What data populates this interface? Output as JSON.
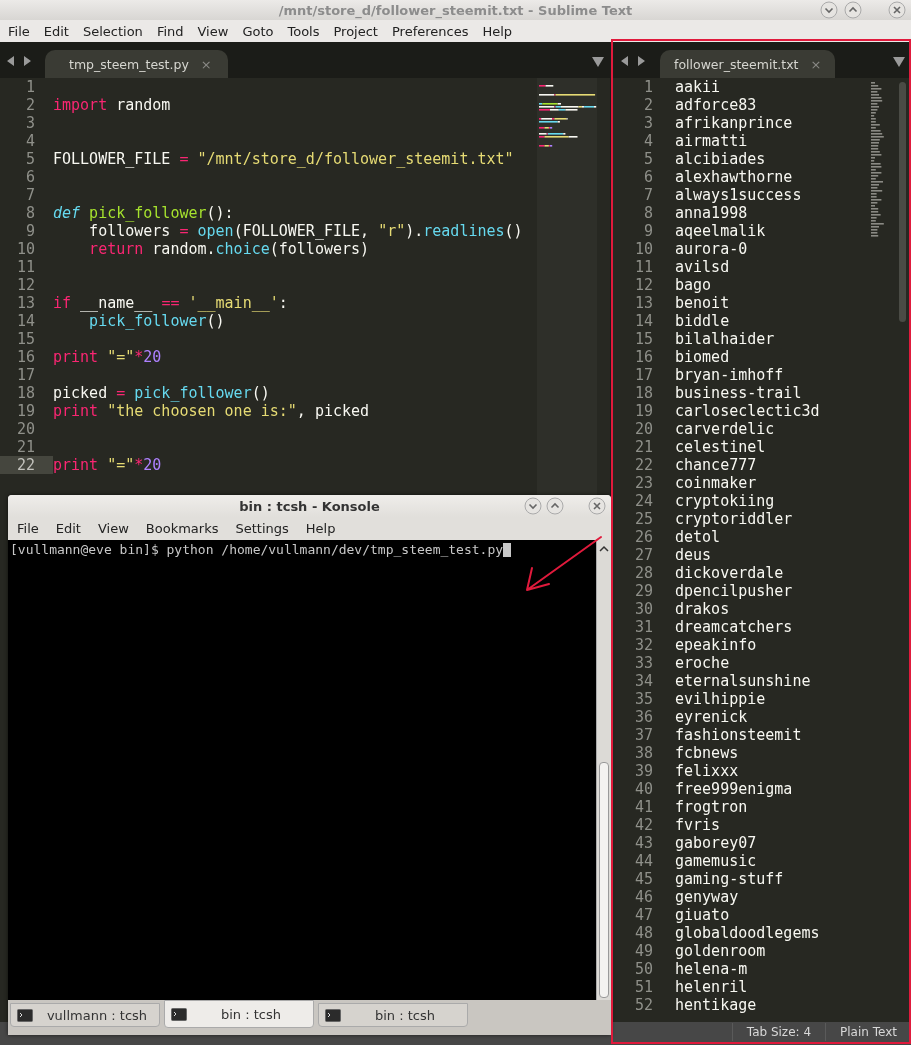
{
  "window": {
    "title": "/mnt/store_d/follower_steemit.txt - Sublime Text"
  },
  "menu": [
    "File",
    "Edit",
    "Selection",
    "Find",
    "View",
    "Goto",
    "Tools",
    "Project",
    "Preferences",
    "Help"
  ],
  "editor": {
    "tab": {
      "label": "tmp_steem_test.py",
      "close": "×"
    },
    "lines": [
      {
        "number": "1",
        "current": false
      },
      {
        "number": "2",
        "current": false,
        "tokens": [
          {
            "kind": "kw",
            "text": "import"
          },
          {
            "kind": "plain",
            "text": " random"
          }
        ]
      },
      {
        "number": "3",
        "current": false
      },
      {
        "number": "4",
        "current": false
      },
      {
        "number": "5",
        "current": false,
        "tokens": [
          {
            "kind": "plain",
            "text": "FOLLOWER_FILE "
          },
          {
            "kind": "kw",
            "text": "="
          },
          {
            "kind": "str",
            "text": " \"/mnt/store_d/follower_steemit.txt\""
          }
        ]
      },
      {
        "number": "6",
        "current": false
      },
      {
        "number": "7",
        "current": false
      },
      {
        "number": "8",
        "current": false,
        "tokens": [
          {
            "kind": "def",
            "text": "def"
          },
          {
            "kind": "fn",
            "text": " pick_follower"
          },
          {
            "kind": "plain",
            "text": "():"
          }
        ]
      },
      {
        "number": "9",
        "current": false,
        "tokens": [
          {
            "kind": "plain",
            "text": "    followers "
          },
          {
            "kind": "kw",
            "text": "="
          },
          {
            "kind": "call",
            "text": " open"
          },
          {
            "kind": "plain",
            "text": "(FOLLOWER_FILE, "
          },
          {
            "kind": "str",
            "text": "\"r\""
          },
          {
            "kind": "plain",
            "text": ")."
          },
          {
            "kind": "call",
            "text": "readlines"
          },
          {
            "kind": "plain",
            "text": "()"
          }
        ]
      },
      {
        "number": "10",
        "current": false,
        "tokens": [
          {
            "kind": "kw",
            "text": "    return"
          },
          {
            "kind": "plain",
            "text": " random."
          },
          {
            "kind": "call",
            "text": "choice"
          },
          {
            "kind": "plain",
            "text": "(followers)"
          }
        ]
      },
      {
        "number": "11",
        "current": false
      },
      {
        "number": "12",
        "current": false
      },
      {
        "number": "13",
        "current": false,
        "tokens": [
          {
            "kind": "kw",
            "text": "if"
          },
          {
            "kind": "plain",
            "text": " __name__ "
          },
          {
            "kind": "kw",
            "text": "=="
          },
          {
            "kind": "str",
            "text": " '__main__'"
          },
          {
            "kind": "plain",
            "text": ":"
          }
        ]
      },
      {
        "number": "14",
        "current": false,
        "tokens": [
          {
            "kind": "call",
            "text": "    pick_follower"
          },
          {
            "kind": "plain",
            "text": "()"
          }
        ]
      },
      {
        "number": "15",
        "current": false
      },
      {
        "number": "16",
        "current": false,
        "tokens": [
          {
            "kind": "kw",
            "text": "print"
          },
          {
            "kind": "str",
            "text": " \"=\""
          },
          {
            "kind": "kw",
            "text": "*"
          },
          {
            "kind": "num",
            "text": "20"
          }
        ]
      },
      {
        "number": "17",
        "current": false
      },
      {
        "number": "18",
        "current": false,
        "tokens": [
          {
            "kind": "plain",
            "text": "picked "
          },
          {
            "kind": "kw",
            "text": "="
          },
          {
            "kind": "call",
            "text": " pick_follower"
          },
          {
            "kind": "plain",
            "text": "()"
          }
        ]
      },
      {
        "number": "19",
        "current": false,
        "tokens": [
          {
            "kind": "kw",
            "text": "print"
          },
          {
            "kind": "str",
            "text": " \"the choosen one is:\""
          },
          {
            "kind": "plain",
            "text": ", picked"
          }
        ]
      },
      {
        "number": "20",
        "current": false
      },
      {
        "number": "21",
        "current": false
      },
      {
        "number": "22",
        "current": true,
        "tokens": [
          {
            "kind": "kw",
            "text": "print"
          },
          {
            "kind": "str",
            "text": " \"=\""
          },
          {
            "kind": "kw",
            "text": "*"
          },
          {
            "kind": "num",
            "text": "20"
          }
        ]
      }
    ]
  },
  "followers": {
    "tab": {
      "label": "follower_steemit.txt",
      "close": "×"
    },
    "lines": [
      {
        "number": "1",
        "text": "aakii"
      },
      {
        "number": "2",
        "text": "adforce83"
      },
      {
        "number": "3",
        "text": "afrikanprince"
      },
      {
        "number": "4",
        "text": "airmatti"
      },
      {
        "number": "5",
        "text": "alcibiades"
      },
      {
        "number": "6",
        "text": "alexhawthorne"
      },
      {
        "number": "7",
        "text": "always1success"
      },
      {
        "number": "8",
        "text": "anna1998"
      },
      {
        "number": "9",
        "text": "aqeelmalik"
      },
      {
        "number": "10",
        "text": "aurora-0"
      },
      {
        "number": "11",
        "text": "avilsd"
      },
      {
        "number": "12",
        "text": "bago"
      },
      {
        "number": "13",
        "text": "benoit"
      },
      {
        "number": "14",
        "text": "biddle"
      },
      {
        "number": "15",
        "text": "bilalhaider"
      },
      {
        "number": "16",
        "text": "biomed"
      },
      {
        "number": "17",
        "text": "bryan-imhoff"
      },
      {
        "number": "18",
        "text": "business-trail"
      },
      {
        "number": "19",
        "text": "carloseclectic3d"
      },
      {
        "number": "20",
        "text": "carverdelic"
      },
      {
        "number": "21",
        "text": "celestinel"
      },
      {
        "number": "22",
        "text": "chance777"
      },
      {
        "number": "23",
        "text": "coinmaker"
      },
      {
        "number": "24",
        "text": "cryptokiing"
      },
      {
        "number": "25",
        "text": "cryptoriddler"
      },
      {
        "number": "26",
        "text": "detol"
      },
      {
        "number": "27",
        "text": "deus"
      },
      {
        "number": "28",
        "text": "dickoverdale"
      },
      {
        "number": "29",
        "text": "dpencilpusher"
      },
      {
        "number": "30",
        "text": "drakos"
      },
      {
        "number": "31",
        "text": "dreamcatchers"
      },
      {
        "number": "32",
        "text": "epeakinfo"
      },
      {
        "number": "33",
        "text": "eroche"
      },
      {
        "number": "34",
        "text": "eternalsunshine"
      },
      {
        "number": "35",
        "text": "evilhippie"
      },
      {
        "number": "36",
        "text": "eyrenick"
      },
      {
        "number": "37",
        "text": "fashionsteemit"
      },
      {
        "number": "38",
        "text": "fcbnews"
      },
      {
        "number": "39",
        "text": "felixxx"
      },
      {
        "number": "40",
        "text": "free999enigma"
      },
      {
        "number": "41",
        "text": "frogtron"
      },
      {
        "number": "42",
        "text": "fvris"
      },
      {
        "number": "43",
        "text": "gaborey07"
      },
      {
        "number": "44",
        "text": "gamemusic"
      },
      {
        "number": "45",
        "text": "gaming-stuff"
      },
      {
        "number": "46",
        "text": "genyway"
      },
      {
        "number": "47",
        "text": "giuato"
      },
      {
        "number": "48",
        "text": "globaldoodlegems"
      },
      {
        "number": "49",
        "text": "goldenroom"
      },
      {
        "number": "50",
        "text": "helena-m"
      },
      {
        "number": "51",
        "text": "helenril"
      },
      {
        "number": "52",
        "text": "hentikage"
      }
    ]
  },
  "status_bar": [
    "Tab Size: 4",
    "Plain Text"
  ],
  "konsole": {
    "title": "bin : tcsh - Konsole",
    "menu": [
      "File",
      "Edit",
      "View",
      "Bookmarks",
      "Settings",
      "Help"
    ],
    "output": "[vullmann@eve bin]$ python /home/vullmann/dev/tmp_steem_test.py",
    "tabs": [
      {
        "label": "vullmann : tcsh",
        "selected": false
      },
      {
        "label": "bin : tcsh",
        "selected": true
      },
      {
        "label": "bin : tcsh",
        "selected": false
      }
    ]
  }
}
